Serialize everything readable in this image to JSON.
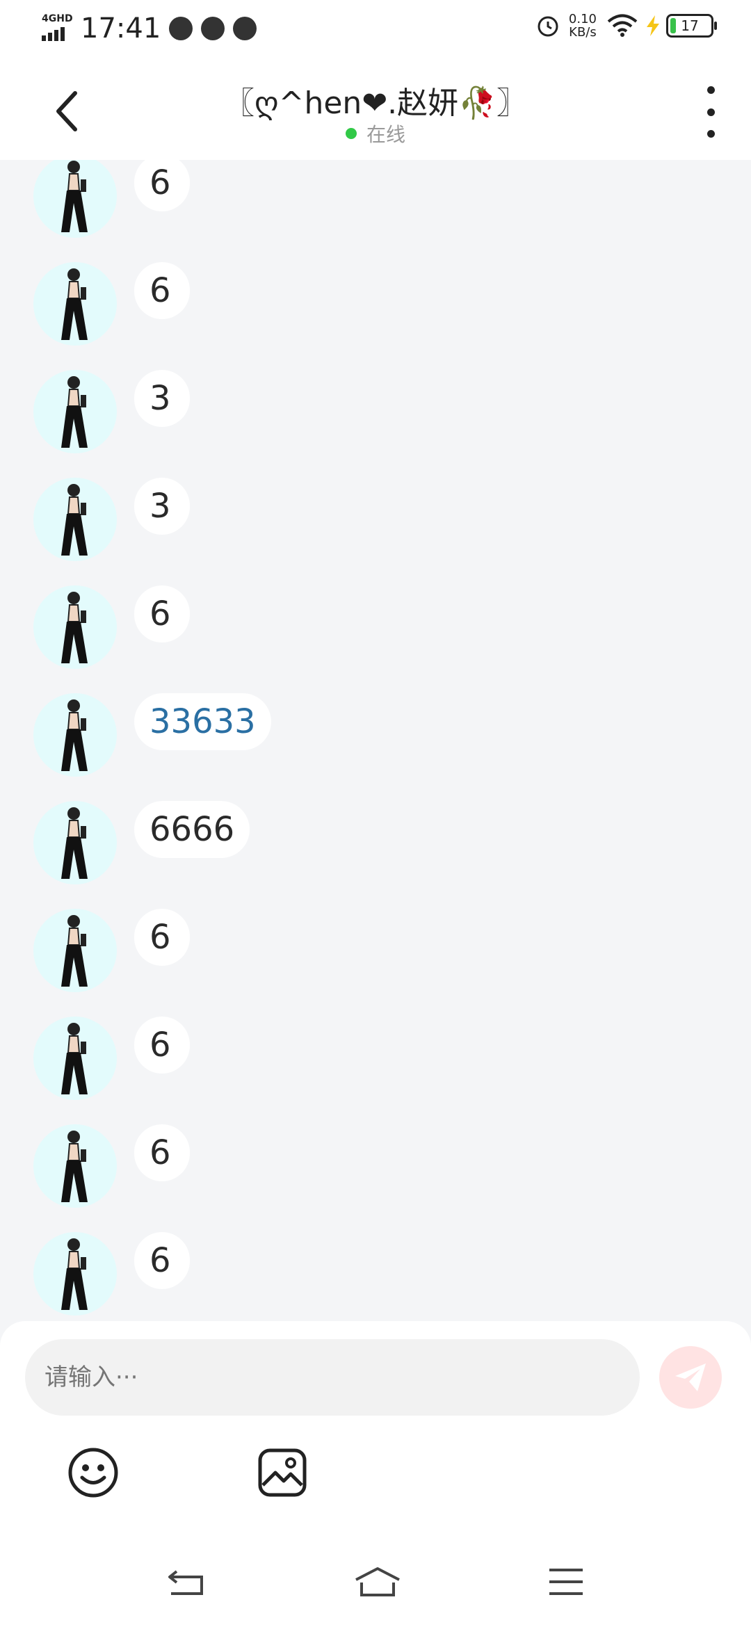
{
  "status_bar": {
    "network": "4GHD",
    "time": "17:41",
    "speed_value": "0.10",
    "speed_unit": "KB/s",
    "battery": "17",
    "icons": [
      "speedometer-icon",
      "wechat-icon",
      "message-icon",
      "alarm-icon",
      "wifi-icon",
      "charging-icon"
    ]
  },
  "header": {
    "title": "〖ღ^hen❤.赵妍🥀〗",
    "status": "在线",
    "status_color": "#31c947"
  },
  "messages": [
    {
      "text": "6"
    },
    {
      "text": "6"
    },
    {
      "text": "3"
    },
    {
      "text": "3"
    },
    {
      "text": "6"
    },
    {
      "text": "33633",
      "is_link": true
    },
    {
      "text": "6666"
    },
    {
      "text": "6"
    },
    {
      "text": "6"
    },
    {
      "text": "6"
    },
    {
      "text": "6"
    }
  ],
  "composer": {
    "placeholder": "请输入···",
    "send_icon": "paper-plane-icon",
    "tools": [
      "emoji-icon",
      "image-icon"
    ]
  },
  "colors": {
    "background": "#f4f5f7",
    "avatar_bg": "#e3fbfc",
    "link": "#2a6fa3",
    "send_bg": "#ffe3e3",
    "send_icon": "#ffffff"
  }
}
